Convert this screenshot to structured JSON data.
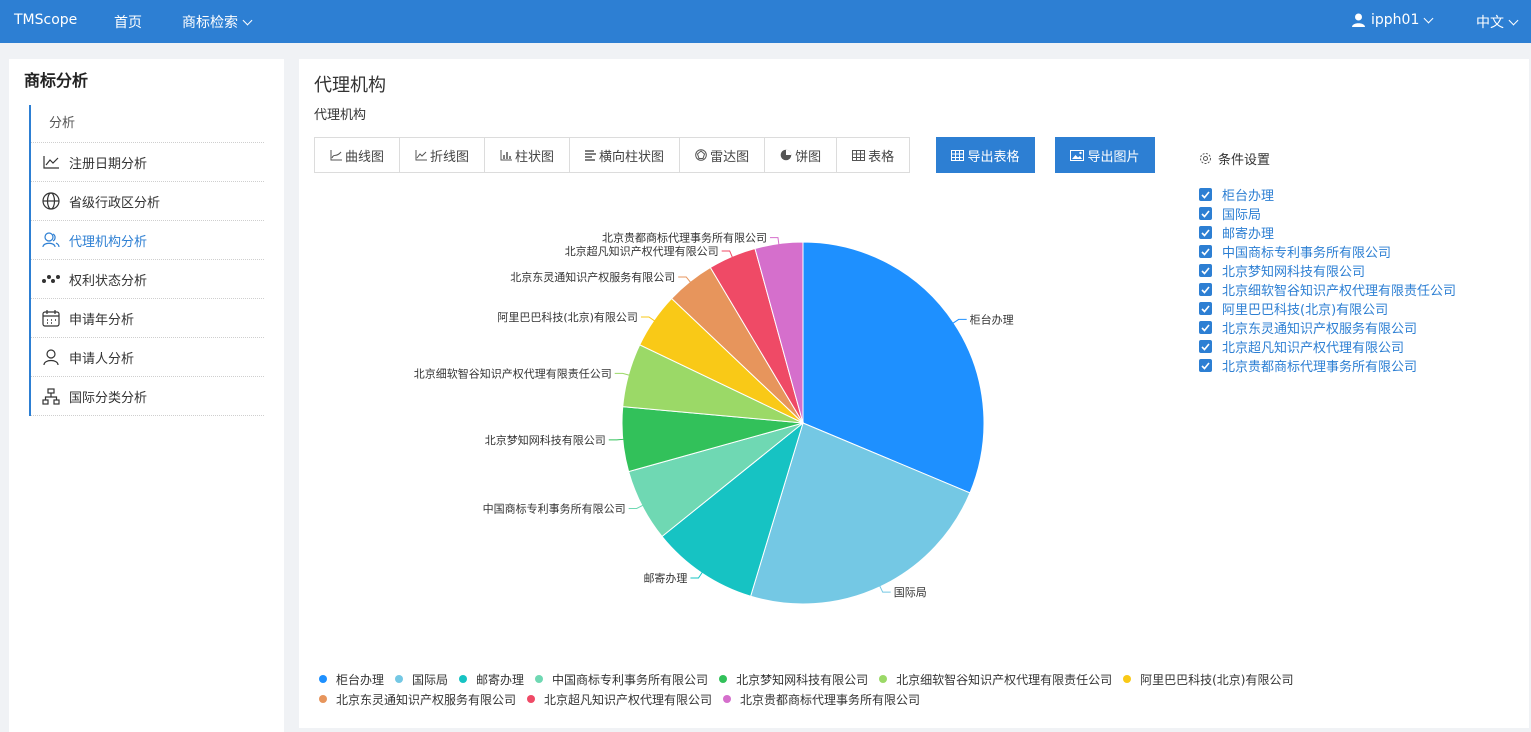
{
  "topbar": {
    "brand": "TMScope",
    "home": "首页",
    "search": "商标检索",
    "user": "ipph01",
    "lang": "中文"
  },
  "sidebar": {
    "title": "商标分析",
    "head": "分析",
    "items": [
      {
        "label": "注册日期分析",
        "icon": "line-chart-icon"
      },
      {
        "label": "省级行政区分析",
        "icon": "globe-icon"
      },
      {
        "label": "代理机构分析",
        "icon": "users-icon"
      },
      {
        "label": "权利状态分析",
        "icon": "dots-icon"
      },
      {
        "label": "申请年分析",
        "icon": "calendar-icon"
      },
      {
        "label": "申请人分析",
        "icon": "person-icon"
      },
      {
        "label": "国际分类分析",
        "icon": "org-chart-icon"
      }
    ]
  },
  "main": {
    "title": "代理机构",
    "subtitle": "代理机构",
    "tabs": [
      "曲线图",
      "折线图",
      "柱状图",
      "横向柱状图",
      "雷达图",
      "饼图",
      "表格"
    ],
    "export_table": "导出表格",
    "export_image": "导出图片",
    "condition_label": "条件设置"
  },
  "checks": [
    "柜台办理",
    "国际局",
    "邮寄办理",
    "中国商标专利事务所有限公司",
    "北京梦知网科技有限公司",
    "北京细软智谷知识产权代理有限责任公司",
    "阿里巴巴科技(北京)有限公司",
    "北京东灵通知识产权服务有限公司",
    "北京超凡知识产权代理有限公司",
    "北京贵都商标代理事务所有限公司"
  ],
  "colors": {
    "accent": "#2d7fd3"
  },
  "chart_data": {
    "type": "pie",
    "series": [
      {
        "name": "柜台办理",
        "value": 31.5,
        "color": "#1e90ff"
      },
      {
        "name": "国际局",
        "value": 23.5,
        "color": "#74c8e4"
      },
      {
        "name": "邮寄办理",
        "value": 9.6,
        "color": "#16c3c3"
      },
      {
        "name": "中国商标专利事务所有限公司",
        "value": 6.5,
        "color": "#6fd8b3"
      },
      {
        "name": "北京梦知网科技有限公司",
        "value": 5.8,
        "color": "#32c15a"
      },
      {
        "name": "北京细软智谷知识产权代理有限责任公司",
        "value": 5.7,
        "color": "#9bd967"
      },
      {
        "name": "阿里巴巴科技(北京)有限公司",
        "value": 5.0,
        "color": "#f9c917"
      },
      {
        "name": "北京东灵通知识产权服务有限公司",
        "value": 4.4,
        "color": "#e7955c"
      },
      {
        "name": "北京超凡知识产权代理有限公司",
        "value": 4.3,
        "color": "#ef4a66"
      },
      {
        "name": "北京贵都商标代理事务所有限公司",
        "value": 4.3,
        "color": "#d56fcc"
      }
    ],
    "legend_position": "bottom-left"
  }
}
